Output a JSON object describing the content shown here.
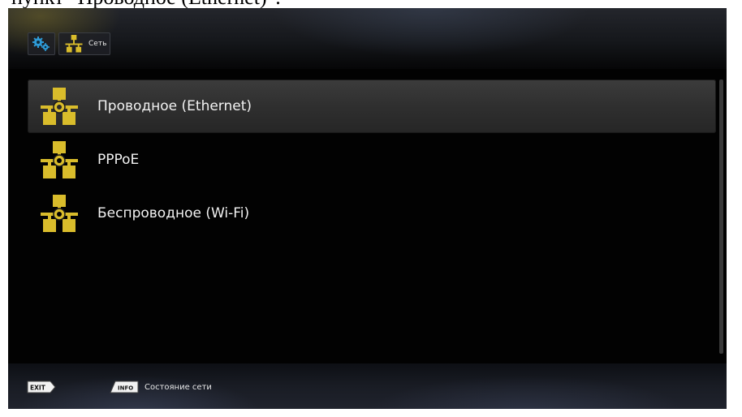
{
  "caption": {
    "text": "пункт \"Проводное (Ethernet)\"."
  },
  "header": {
    "breadcrumb": [
      {
        "icon": "gears-icon",
        "label": ""
      },
      {
        "icon": "network-icon",
        "label": "Сеть"
      }
    ]
  },
  "menu": {
    "items": [
      {
        "icon": "network-icon",
        "label": "Проводное (Ethernet)",
        "selected": true
      },
      {
        "icon": "network-icon",
        "label": "PPPoE",
        "selected": false
      },
      {
        "icon": "network-icon",
        "label": "Беспроводное (Wi-Fi)",
        "selected": false
      }
    ]
  },
  "footer": {
    "exit_key": "EXIT",
    "info_key": "INFO",
    "info_label": "Состояние сети"
  },
  "colors": {
    "icon_yellow": "#d9bc2b",
    "icon_dark": "#9c8416",
    "gear_blue": "#2e9ad6"
  }
}
